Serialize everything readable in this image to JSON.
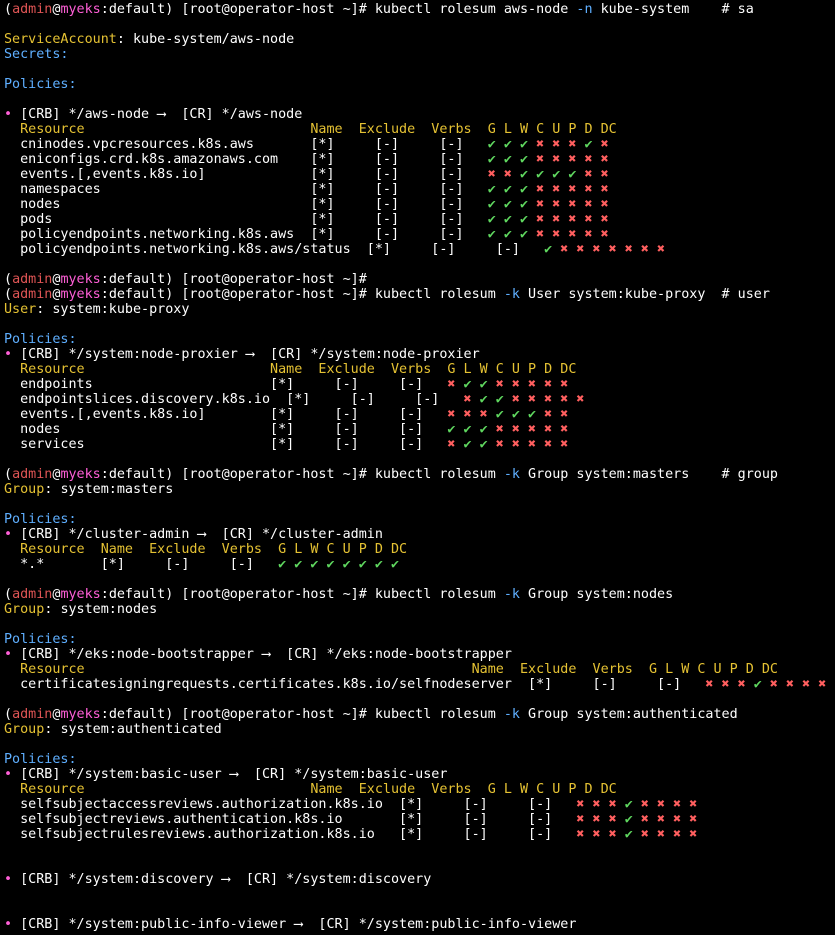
{
  "prompt": {
    "open": "(",
    "user": "admin",
    "at": "@",
    "cluster": "myeks",
    "colon": ":",
    "ns": "default",
    "close": ")",
    "host": "[root@operator-host ~]#"
  },
  "mark": "✔",
  "cross": "✖",
  "blocks": [
    {
      "cmd_pre": "kubectl rolesum aws-node ",
      "cmd_flag": "-n",
      "cmd_post": " kube-system    # sa",
      "subject_key": "ServiceAccount",
      "subject_val": "kube-system/aws-node",
      "secrets": "Secrets:",
      "policies": "Policies:",
      "crb": "[CRB] */aws-node ",
      "arrow": "⟶",
      "cr": "  [CR] */aws-node",
      "header": "  Resource                            Name  Exclude  Verbs  ",
      "verbs_header": "G L W C U P D DC",
      "rows": [
        {
          "text": "  cninodes.vpcresources.k8s.aws       [*]     [-]     [-]   ",
          "verbs": "✔ ✔ ✔ ✖ ✖ ✖ ✔ ✖"
        },
        {
          "text": "  eniconfigs.crd.k8s.amazonaws.com    [*]     [-]     [-]   ",
          "verbs": "✔ ✔ ✔ ✖ ✖ ✖ ✖ ✖"
        },
        {
          "text": "  events.[,events.k8s.io]             [*]     [-]     [-]   ",
          "verbs": "✖ ✖ ✔ ✔ ✔ ✔ ✖ ✖"
        },
        {
          "text": "  namespaces                          [*]     [-]     [-]   ",
          "verbs": "✔ ✔ ✔ ✖ ✖ ✖ ✖ ✖"
        },
        {
          "text": "  nodes                               [*]     [-]     [-]   ",
          "verbs": "✔ ✔ ✔ ✖ ✖ ✖ ✖ ✖"
        },
        {
          "text": "  pods                                [*]     [-]     [-]   ",
          "verbs": "✔ ✔ ✔ ✖ ✖ ✖ ✖ ✖"
        },
        {
          "text": "  policyendpoints.networking.k8s.aws  [*]     [-]     [-]   ",
          "verbs": "✔ ✔ ✔ ✖ ✖ ✖ ✖ ✖"
        },
        {
          "text": "  policyendpoints.networking.k8s.aws/status  [*]     [-]     [-]   ",
          "verbs": "✔ ✖ ✖ ✖ ✖ ✖ ✖ ✖"
        }
      ]
    },
    {
      "cmd_pre": "kubectl rolesum ",
      "cmd_flag": "-k",
      "cmd_post": " User system:kube-proxy  # user",
      "subject_key": "User",
      "subject_val": "system:kube-proxy",
      "policies": "Policies:",
      "crb": "[CRB] */system:node-proxier ",
      "arrow": "⟶",
      "cr": "  [CR] */system:node-proxier",
      "header": "  Resource                       Name  Exclude  Verbs  ",
      "verbs_header": "G L W C U P D DC",
      "rows": [
        {
          "text": "  endpoints                      [*]     [-]     [-]   ",
          "verbs": "✖ ✔ ✔ ✖ ✖ ✖ ✖ ✖"
        },
        {
          "text": "  endpointslices.discovery.k8s.io  [*]     [-]     [-]   ",
          "verbs": "✖ ✔ ✔ ✖ ✖ ✖ ✖ ✖"
        },
        {
          "text": "  events.[,events.k8s.io]        [*]     [-]     [-]   ",
          "verbs": "✖ ✖ ✖ ✔ ✔ ✔ ✖ ✖"
        },
        {
          "text": "  nodes                          [*]     [-]     [-]   ",
          "verbs": "✔ ✔ ✔ ✖ ✖ ✖ ✖ ✖"
        },
        {
          "text": "  services                       [*]     [-]     [-]   ",
          "verbs": "✖ ✔ ✔ ✖ ✖ ✖ ✖ ✖"
        }
      ]
    },
    {
      "cmd_pre": "kubectl rolesum ",
      "cmd_flag": "-k",
      "cmd_post": " Group system:masters    # group",
      "subject_key": "Group",
      "subject_val": "system:masters",
      "policies": "Policies:",
      "crb": "[CRB] */cluster-admin ",
      "arrow": "⟶",
      "cr": "  [CR] */cluster-admin",
      "header": "  Resource  Name  Exclude  Verbs  ",
      "verbs_header": "G L W C U P D DC",
      "rows": [
        {
          "text": "  *.*       [*]     [-]     [-]   ",
          "verbs": "✔ ✔ ✔ ✔ ✔ ✔ ✔ ✔"
        }
      ]
    },
    {
      "cmd_pre": "kubectl rolesum ",
      "cmd_flag": "-k",
      "cmd_post": " Group system:nodes",
      "subject_key": "Group",
      "subject_val": "system:nodes",
      "policies": "Policies:",
      "crb": "[CRB] */eks:node-bootstrapper ",
      "arrow": "⟶",
      "cr": "  [CR] */eks:node-bootstrapper",
      "header": "  Resource                                                Name  Exclude  Verbs  ",
      "verbs_header": "G L W C U P D DC",
      "rows": [
        {
          "text": "  certificatesigningrequests.certificates.k8s.io/selfnodeserver  [*]     [-]     [-]   ",
          "verbs": "✖ ✖ ✖ ✔ ✖ ✖ ✖ ✖"
        }
      ]
    },
    {
      "cmd_pre": "kubectl rolesum ",
      "cmd_flag": "-k",
      "cmd_post": " Group system:authenticated",
      "subject_key": "Group",
      "subject_val": "system:authenticated",
      "policies": "Policies:",
      "crb": "[CRB] */system:basic-user ",
      "arrow": "⟶",
      "cr": "  [CR] */system:basic-user",
      "header": "  Resource                            Name  Exclude  Verbs  ",
      "verbs_header": "G L W C U P D DC",
      "rows": [
        {
          "text": "  selfsubjectaccessreviews.authorization.k8s.io  [*]     [-]     [-]   ",
          "verbs": "✖ ✖ ✖ ✔ ✖ ✖ ✖ ✖"
        },
        {
          "text": "  selfsubjectreviews.authentication.k8s.io       [*]     [-]     [-]   ",
          "verbs": "✖ ✖ ✖ ✔ ✖ ✖ ✖ ✖"
        },
        {
          "text": "  selfsubjectrulesreviews.authorization.k8s.io   [*]     [-]     [-]   ",
          "verbs": "✖ ✖ ✖ ✔ ✖ ✖ ✖ ✖"
        }
      ]
    }
  ],
  "bare_prompt_suffix": "",
  "extra_bindings": [
    {
      "crb": "[CRB] */system:discovery ",
      "arrow": "⟶",
      "cr": "  [CR] */system:discovery"
    },
    {
      "crb": "[CRB] */system:public-info-viewer ",
      "arrow": "⟶",
      "cr": "  [CR] */system:public-info-viewer"
    }
  ]
}
